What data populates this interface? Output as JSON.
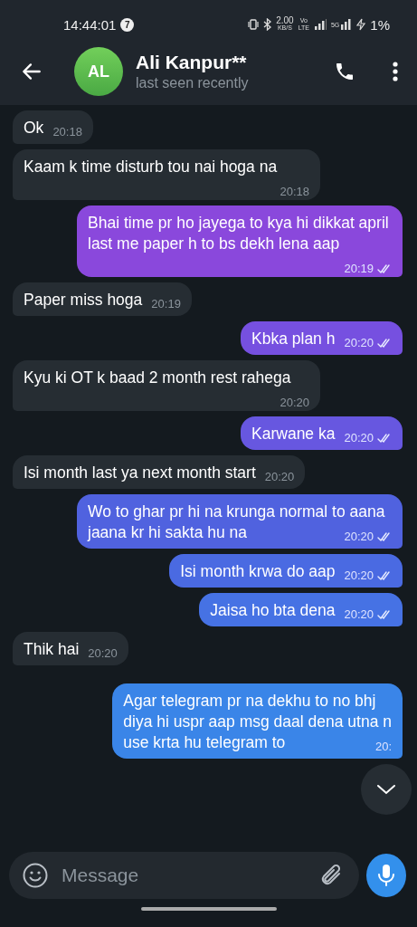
{
  "status_bar": {
    "time": "14:44:01",
    "notification_count": "7",
    "speed": "2.00",
    "speed_unit": "KB/S",
    "volte": "Vo",
    "volte_sub": "LTE",
    "network": "5G",
    "battery": "1%"
  },
  "header": {
    "avatar_initials": "AL",
    "name": "Ali Kanpur**",
    "status": "last seen recently"
  },
  "messages": [
    {
      "kind": "incoming",
      "text": "Ok",
      "time": "20:18"
    },
    {
      "kind": "incoming",
      "text": "Kaam k time disturb tou nai hoga na",
      "time": "20:18"
    },
    {
      "kind": "outgoing",
      "text": "Bhai time pr ho jayega to kya hi dikkat april last me paper h to bs dekh lena aap",
      "time": "20:19",
      "read": true,
      "color": "#8a48dc"
    },
    {
      "kind": "incoming",
      "text": "Paper miss hoga",
      "time": "20:19"
    },
    {
      "kind": "outgoing",
      "text": "Kbka plan h",
      "time": "20:20",
      "read": true,
      "color": "#7650e0"
    },
    {
      "kind": "incoming",
      "text": "Kyu ki OT k baad 2 month rest rahega",
      "time": "20:20"
    },
    {
      "kind": "outgoing",
      "text": "Karwane ka",
      "time": "20:20",
      "read": true,
      "color": "#6757e0"
    },
    {
      "kind": "incoming",
      "text": "Isi month last ya next month start",
      "time": "20:20"
    },
    {
      "kind": "outgoing",
      "text": "Wo to ghar pr hi na krunga normal to aana jaana kr hi sakta hu na",
      "time": "20:20",
      "read": true,
      "color": "#5062df"
    },
    {
      "kind": "outgoing",
      "text": "Isi month krwa do aap",
      "time": "20:20",
      "read": true,
      "color": "#4a6ae2"
    },
    {
      "kind": "outgoing",
      "text": "Jaisa ho bta dena",
      "time": "20:20",
      "read": true,
      "color": "#4672e4"
    },
    {
      "kind": "incoming",
      "text": "Thik hai",
      "time": "20:20"
    },
    {
      "kind": "outgoing",
      "text": "Agar telegram pr na dekhu to no bhj\ndiya hi uspr aap msg daal dena utna n\nuse krta hu telegram to",
      "time": "20:",
      "read": false,
      "color": "#3a85e8"
    }
  ],
  "composer": {
    "placeholder": "Message"
  }
}
